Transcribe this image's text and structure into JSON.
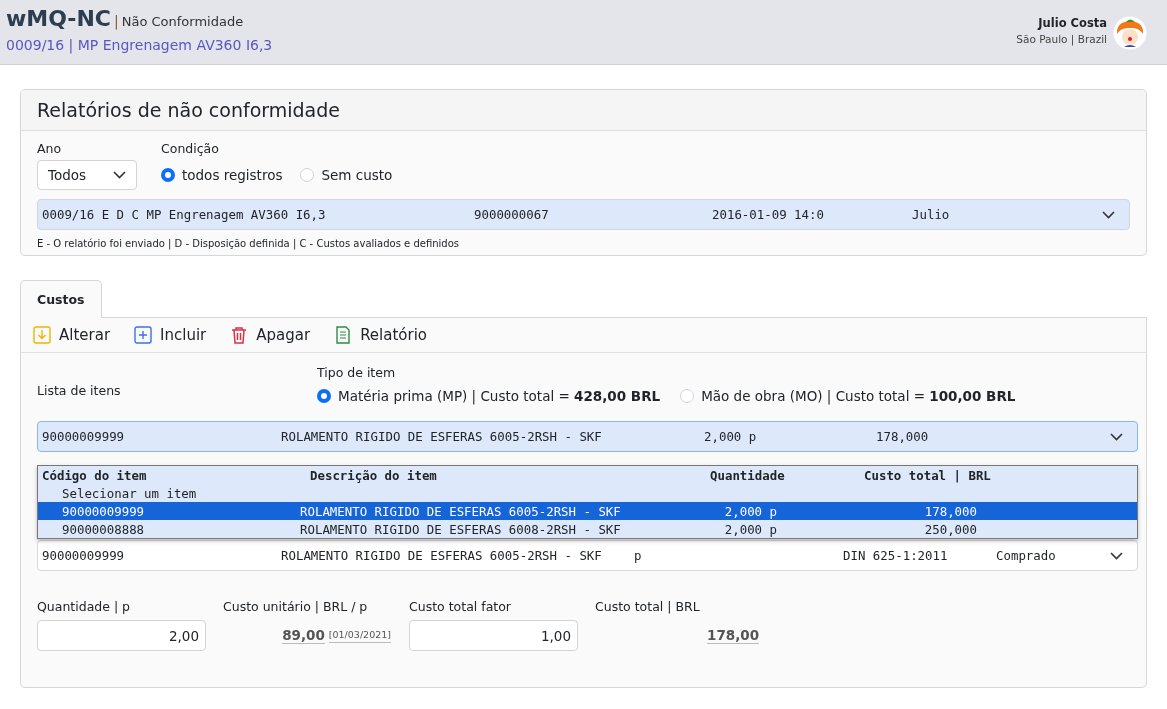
{
  "header": {
    "brand": "wMQ-NC",
    "separator": "|",
    "module": "Não Conformidade",
    "record": "0009/16 | MP Engrenagem AV360 I6,3",
    "user": {
      "name": "Julio Costa",
      "location": "São Paulo | Brazil"
    }
  },
  "report_panel": {
    "title": "Relatórios de não conformidade",
    "year": {
      "label": "Ano",
      "value": "Todos"
    },
    "condition": {
      "label": "Condição",
      "options": [
        {
          "label": "todos registros",
          "selected": true
        },
        {
          "label": "Sem custo",
          "selected": false
        }
      ]
    },
    "record_select": {
      "columns": [
        "0009/16  E D C MP Engrenagem AV360 I6,3",
        "9000000067",
        "2016-01-09 14:0",
        "Julio"
      ]
    },
    "legend": "E - O relatório foi enviado | D - Disposição definida | C - Custos avaliados e definidos"
  },
  "tabs": [
    {
      "label": "Custos",
      "selected": true
    }
  ],
  "toolbar": [
    {
      "label": "Alterar",
      "kind": "edit"
    },
    {
      "label": "Incluir",
      "kind": "add"
    },
    {
      "label": "Apagar",
      "kind": "delete"
    },
    {
      "label": "Relatório",
      "kind": "report"
    }
  ],
  "items": {
    "list_label": "Lista de itens",
    "type_label": "Tipo de item",
    "types": [
      {
        "label": "Matéria prima (MP) | Custo total = **428,00 BRL**",
        "selected": true
      },
      {
        "label": "Mão de obra (MO) | Custo total = **100,00 BRL**",
        "selected": false
      }
    ],
    "item_select": {
      "columns": [
        "90000009999",
        "ROLAMENTO RIGIDO DE ESFERAS 6005-2RSH - SKF",
        "2,000 p",
        "178,000"
      ]
    },
    "dropdown": {
      "header": [
        "Código do item",
        "Descrição do item",
        "Quantidade",
        "Custo total | BRL"
      ],
      "options": [
        {
          "cells": [
            "Selecionar um item"
          ],
          "selected": false
        },
        {
          "cells": [
            "90000009999",
            "ROLAMENTO RIGIDO DE ESFERAS 6005-2RSH - SKF",
            "2,000 p",
            "178,000"
          ],
          "selected": true
        },
        {
          "cells": [
            "90000008888",
            "ROLAMENTO RIGIDO DE ESFERAS 6008-2RSH - SKF",
            "2,000 p",
            "250,000"
          ],
          "selected": false
        }
      ]
    },
    "detail_select": {
      "columns": [
        "90000009999",
        "ROLAMENTO RIGIDO DE ESFERAS 6005-2RSH - SKF",
        "p",
        "DIN 625-1:2011",
        "Comprado"
      ]
    },
    "fields": [
      {
        "label": "Quantidade | p",
        "kind": "input",
        "value": "2,00"
      },
      {
        "label": "Custo unitário | BRL / p",
        "kind": "readout",
        "value": "89,00",
        "note": "[01/03/2021]"
      },
      {
        "label": "Custo total fator",
        "kind": "input",
        "value": "1,00"
      },
      {
        "label": "Custo total | BRL",
        "kind": "readout",
        "value": "178,00"
      }
    ]
  }
}
